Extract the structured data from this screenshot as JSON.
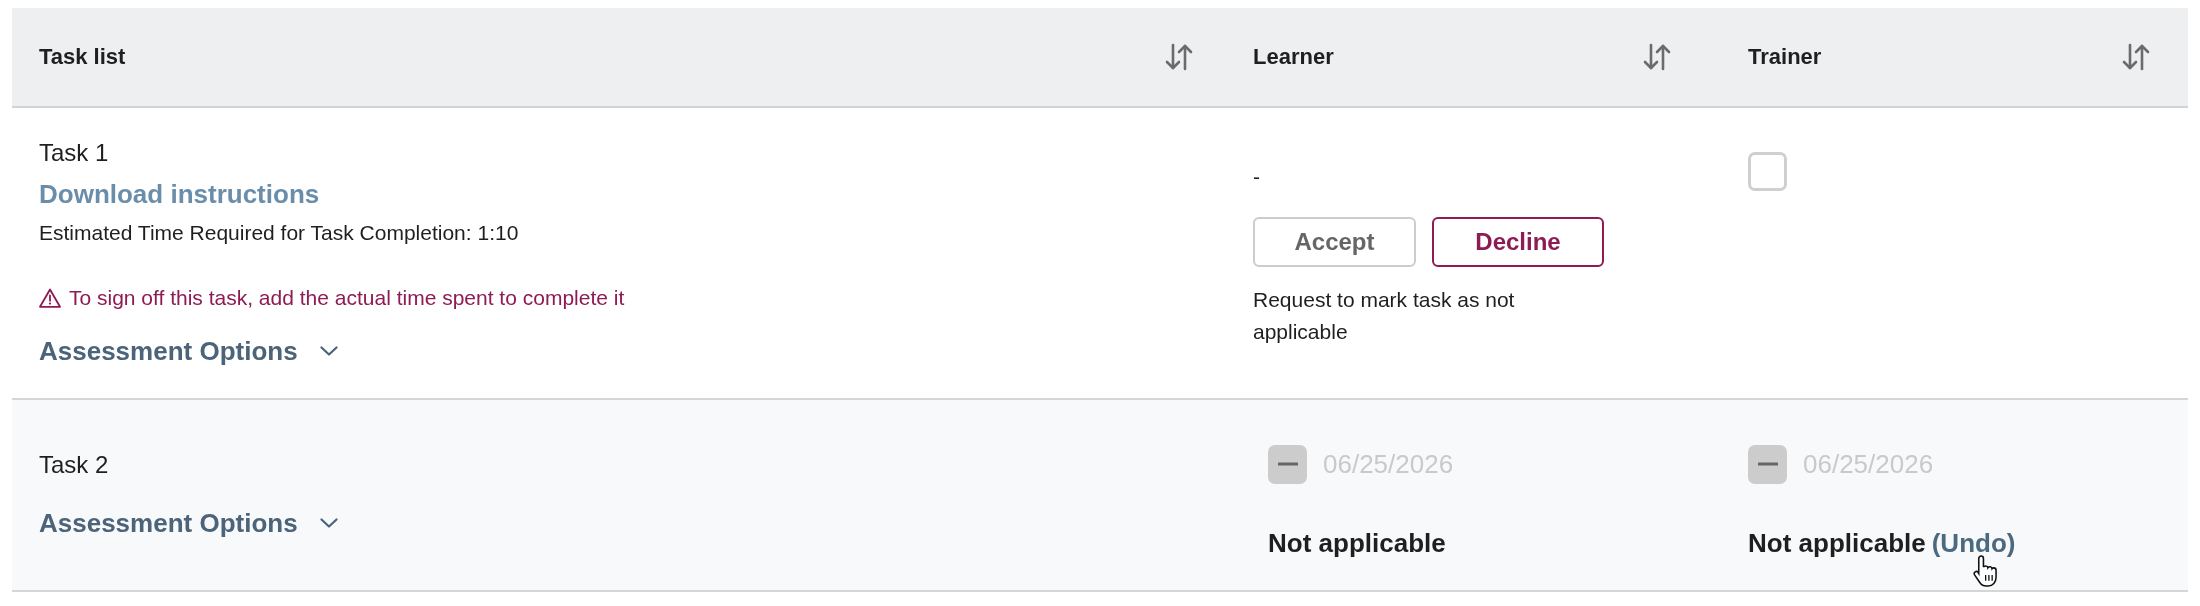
{
  "table": {
    "columns": [
      {
        "label": "Task list"
      },
      {
        "label": "Learner"
      },
      {
        "label": "Trainer"
      }
    ],
    "rows": [
      {
        "task": {
          "title": "Task 1",
          "link": "Download instructions",
          "estimate": "Estimated Time Required for Task Completion: 1:10",
          "warning": "To sign off this task, add the actual time spent to complete it",
          "options": {
            "label": "Assessment Options",
            "expanded": false
          }
        },
        "learner": {
          "kind": "request",
          "value": "-",
          "actions": [
            {
              "kind": "accept",
              "label": "Accept"
            },
            {
              "kind": "decline",
              "label": "Decline"
            }
          ],
          "note": "Request to mark task as not applicable"
        },
        "trainer": {
          "kind": "checkbox",
          "checkbox": {
            "checked": false
          }
        }
      },
      {
        "task": {
          "title": "Task 2",
          "options": {
            "label": "Assessment Options",
            "expanded": false
          }
        },
        "learner": {
          "kind": "not_applicable",
          "checkbox": {
            "indeterminate": true,
            "disabled": true
          },
          "date": "06/25/2026",
          "status": "Not applicable"
        },
        "trainer": {
          "kind": "not_applicable",
          "checkbox": {
            "indeterminate": true,
            "disabled": true
          },
          "date": "06/25/2026",
          "status": "Not applicable",
          "undo": "(Undo)"
        }
      }
    ]
  }
}
